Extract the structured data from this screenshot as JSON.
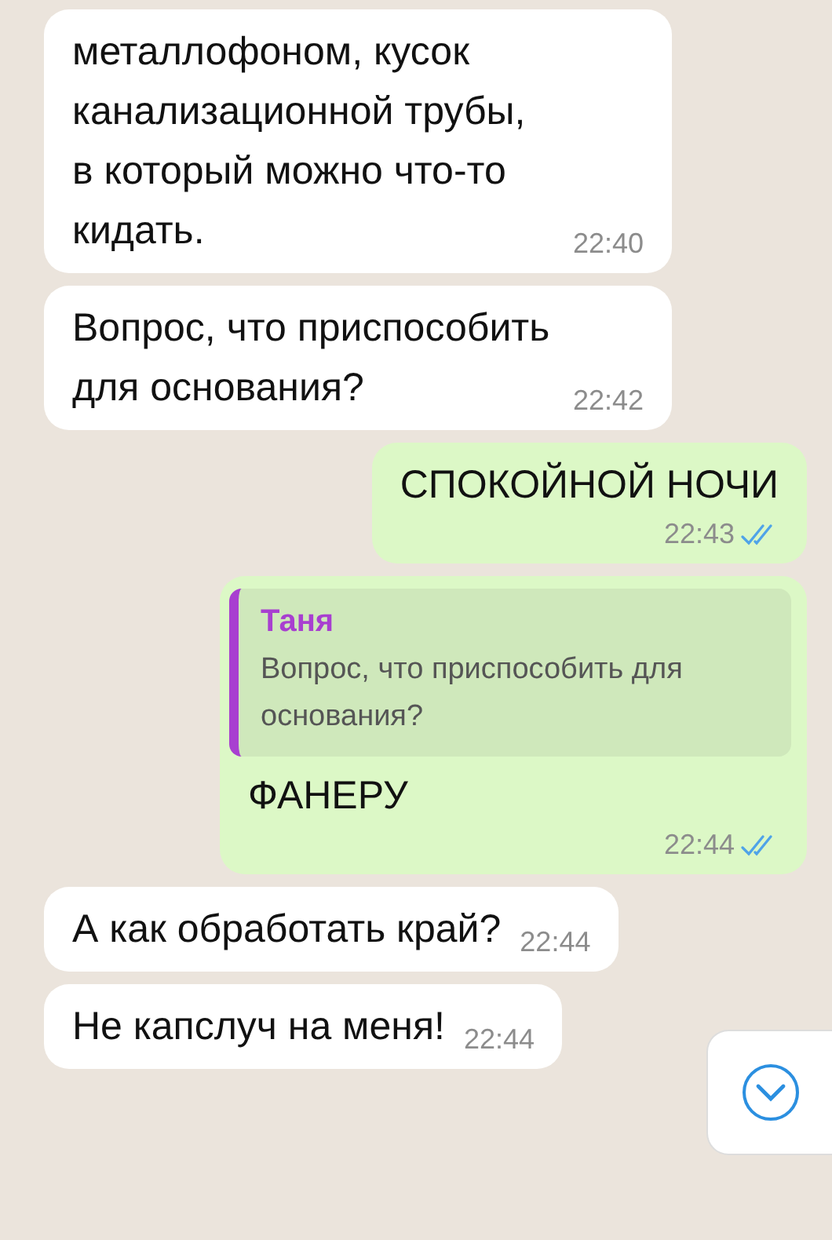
{
  "messages": [
    {
      "outgoing": false,
      "text": "металлофоном, кусок канализационной трубы, в который можно что-то кидать.",
      "time": "22:40"
    },
    {
      "outgoing": false,
      "text": "Вопрос, что приспособить для основания?",
      "time": "22:42"
    },
    {
      "outgoing": true,
      "text": "СПОКОЙНОЙ НОЧИ",
      "time": "22:43",
      "read": true
    },
    {
      "outgoing": true,
      "reply_to": {
        "author": "Таня",
        "text": "Вопрос, что приспособить для основания?"
      },
      "text": "ФАНЕРУ",
      "time": "22:44",
      "read": true
    },
    {
      "outgoing": false,
      "text": "А как обработать край?",
      "time": "22:44"
    },
    {
      "outgoing": false,
      "text": "Не капслуч на меня!",
      "time": "22:44"
    }
  ]
}
